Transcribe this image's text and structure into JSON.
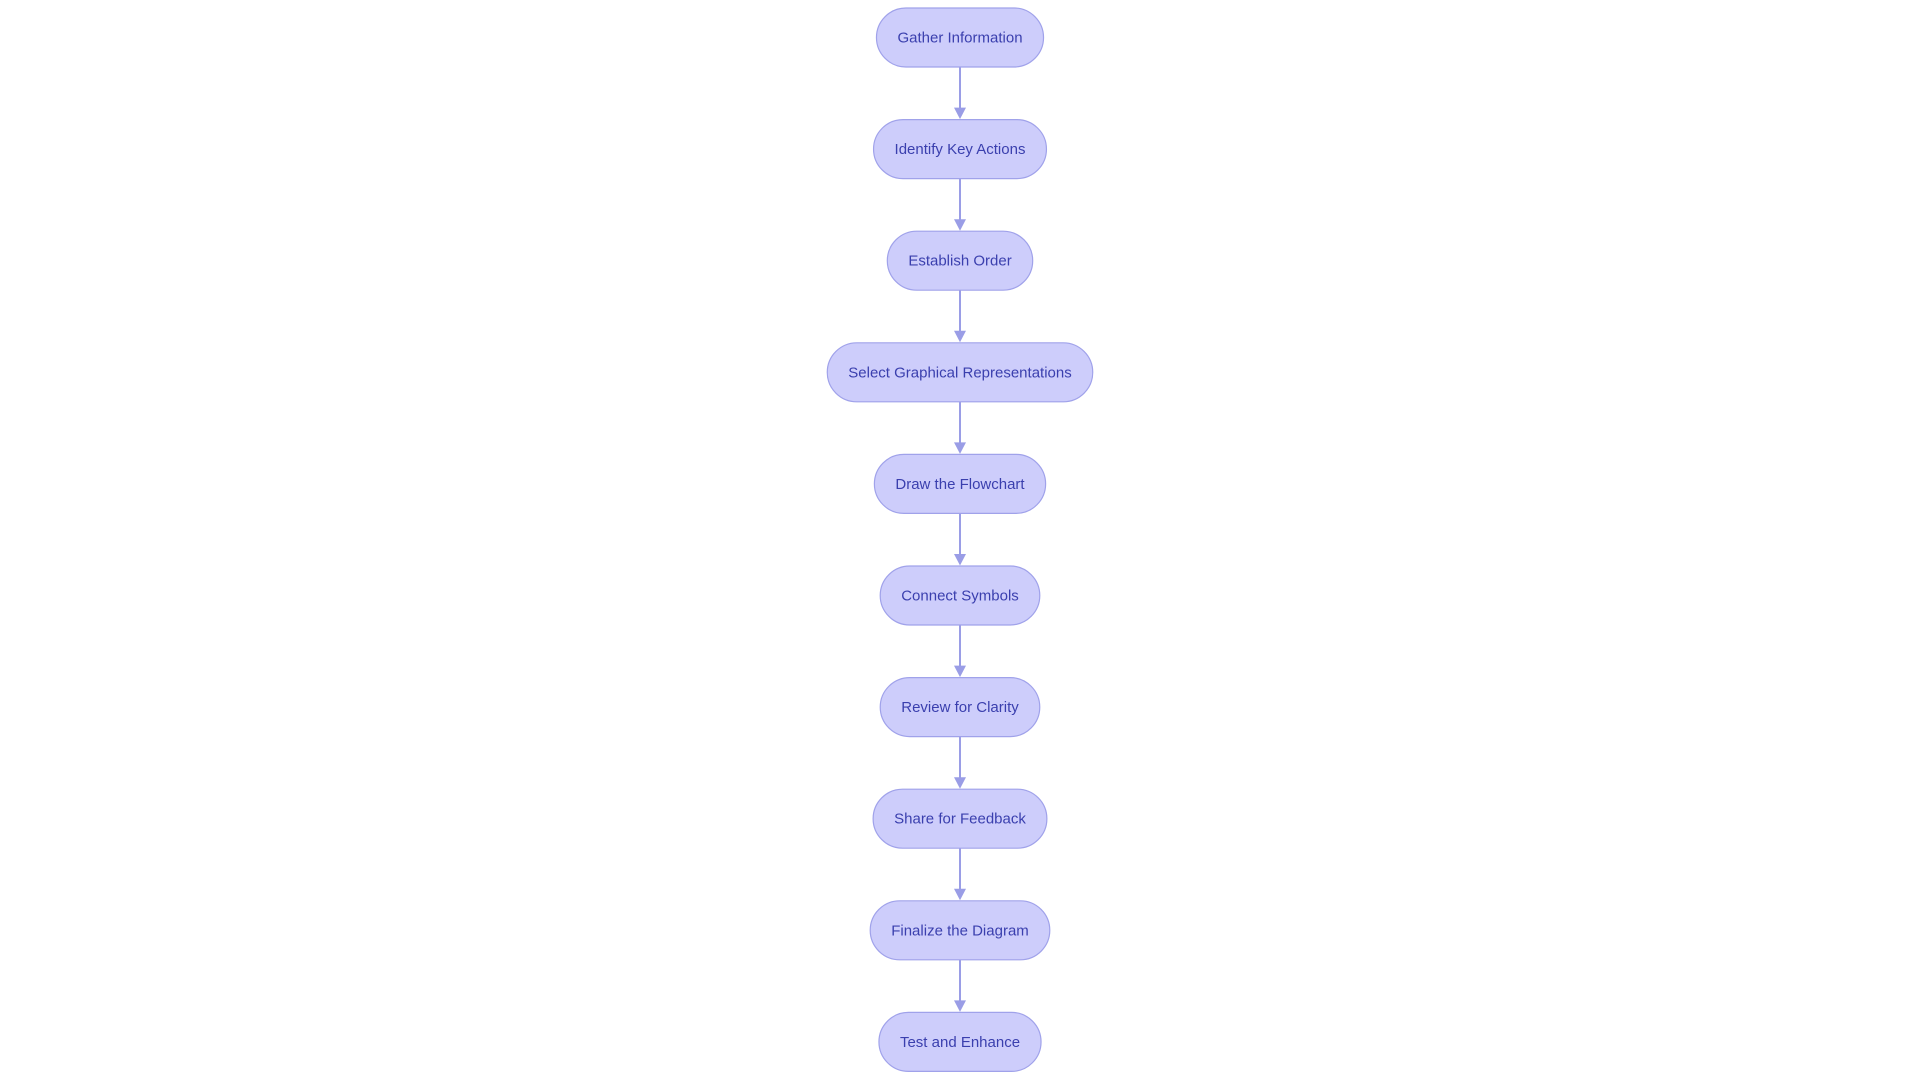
{
  "diagram": {
    "type": "flowchart",
    "direction": "top-to-bottom",
    "colors": {
      "node_fill": "#cdcdfb",
      "node_stroke": "#a0a2ea",
      "node_text": "#3a3fae",
      "edge": "#9a9de6"
    },
    "nodes": [
      {
        "id": "n1",
        "label": "Gather Information"
      },
      {
        "id": "n2",
        "label": "Identify Key Actions"
      },
      {
        "id": "n3",
        "label": "Establish Order"
      },
      {
        "id": "n4",
        "label": "Select Graphical Representations"
      },
      {
        "id": "n5",
        "label": "Draw the Flowchart"
      },
      {
        "id": "n6",
        "label": "Connect Symbols"
      },
      {
        "id": "n7",
        "label": "Review for Clarity"
      },
      {
        "id": "n8",
        "label": "Share for Feedback"
      },
      {
        "id": "n9",
        "label": "Finalize the Diagram"
      },
      {
        "id": "n10",
        "label": "Test and Enhance"
      }
    ],
    "edges": [
      {
        "from": "n1",
        "to": "n2"
      },
      {
        "from": "n2",
        "to": "n3"
      },
      {
        "from": "n3",
        "to": "n4"
      },
      {
        "from": "n4",
        "to": "n5"
      },
      {
        "from": "n5",
        "to": "n6"
      },
      {
        "from": "n6",
        "to": "n7"
      },
      {
        "from": "n7",
        "to": "n8"
      },
      {
        "from": "n8",
        "to": "n9"
      },
      {
        "from": "n9",
        "to": "n10"
      }
    ]
  }
}
